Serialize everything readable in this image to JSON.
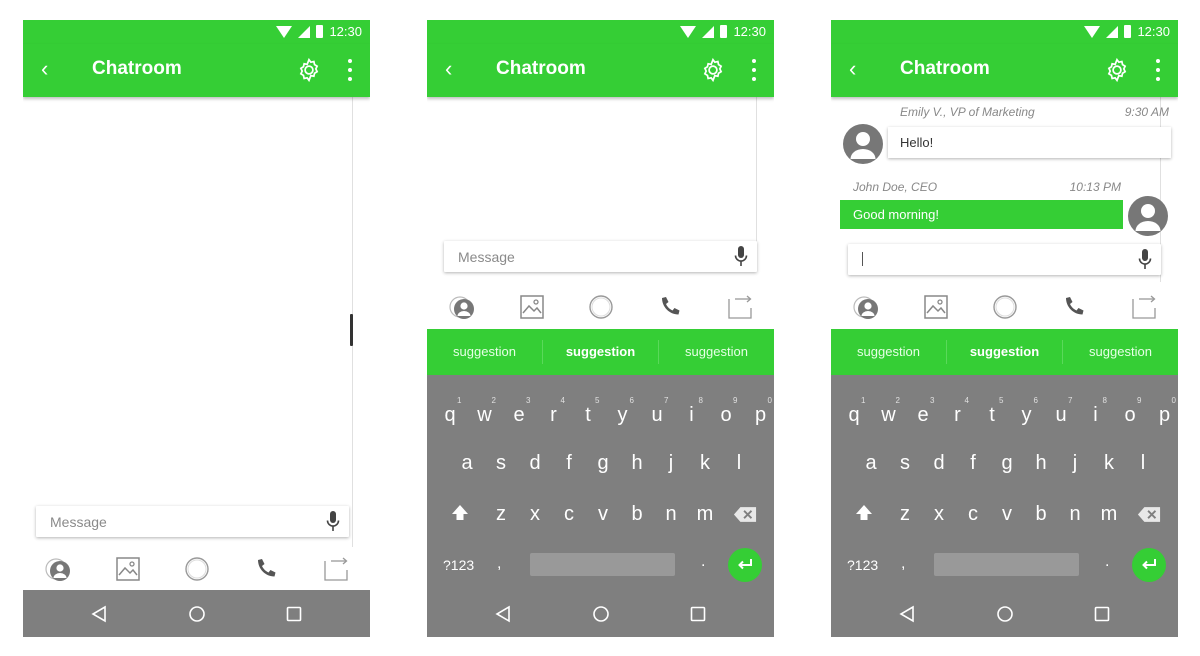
{
  "status_bar": {
    "time": "12:30"
  },
  "app_bar": {
    "title": "Chatroom"
  },
  "composer": {
    "placeholder": "Message"
  },
  "suggestions": [
    "suggestion",
    "suggestion",
    "suggestion"
  ],
  "keyboard": {
    "row1": [
      {
        "key": "q",
        "num": "1"
      },
      {
        "key": "w",
        "num": "2"
      },
      {
        "key": "e",
        "num": "3"
      },
      {
        "key": "r",
        "num": "4"
      },
      {
        "key": "t",
        "num": "5"
      },
      {
        "key": "y",
        "num": "6"
      },
      {
        "key": "u",
        "num": "7"
      },
      {
        "key": "i",
        "num": "8"
      },
      {
        "key": "o",
        "num": "9"
      },
      {
        "key": "p",
        "num": "0"
      }
    ],
    "row2": [
      "a",
      "s",
      "d",
      "f",
      "g",
      "h",
      "j",
      "k",
      "l"
    ],
    "row3": [
      "z",
      "x",
      "c",
      "v",
      "b",
      "n",
      "m"
    ],
    "symbols": "?123",
    "comma": ",",
    "period": "."
  },
  "chat": {
    "messages": [
      {
        "sender": "Emily V., VP of Marketing",
        "time": "9:30 AM",
        "text": "Hello!",
        "direction": "incoming"
      },
      {
        "sender": "John Doe, CEO",
        "time": "10:13 PM",
        "text": "Good morning!",
        "direction": "outgoing"
      }
    ]
  },
  "icons": {
    "toolbar": [
      "contacts-icon",
      "image-icon",
      "circle-icon",
      "phone-icon",
      "forward-icon"
    ],
    "nav": [
      "nav-back-icon",
      "nav-home-icon",
      "nav-recents-icon"
    ]
  },
  "colors": {
    "accent": "#35ce35",
    "keyboard": "#7f7f7f",
    "navbar": "#7f7f7f"
  }
}
